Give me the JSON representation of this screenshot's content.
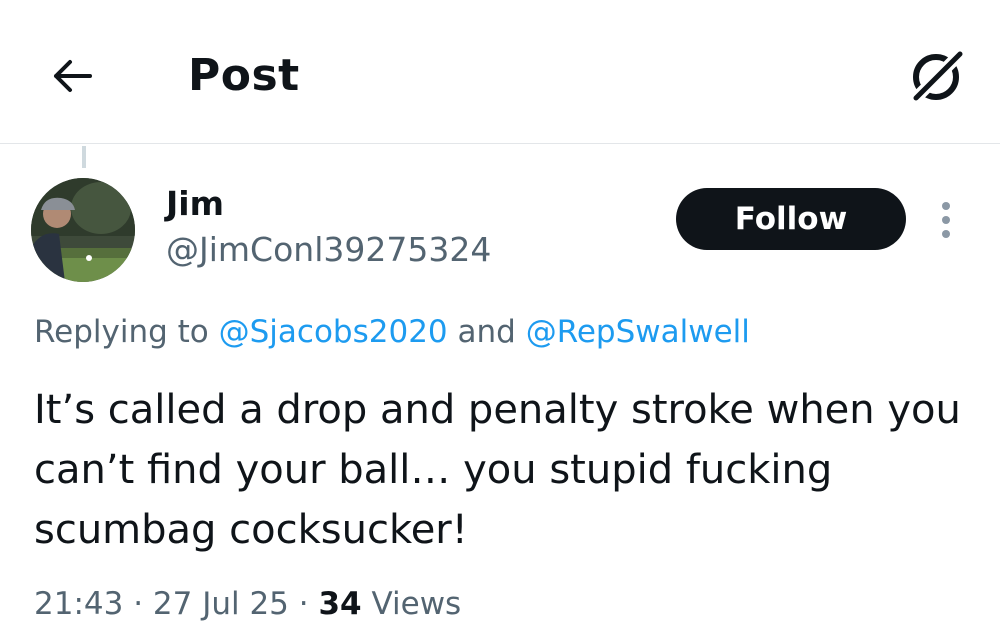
{
  "header": {
    "title": "Post",
    "back_icon": "arrow-left-icon",
    "grok_icon": "grok-icon"
  },
  "tweet": {
    "author": {
      "display_name": "Jim",
      "handle": "@JimConl39275324"
    },
    "follow_label": "Follow",
    "replying_prefix": "Replying to ",
    "mention_1": "@Sjacobs2020",
    "replying_and": " and ",
    "mention_2": "@RepSwalwell",
    "text": "It’s called a drop and penalty stroke when you can’t find your ball… you stupid fucking scumbag cocksucker!",
    "time": "21:43",
    "sep_1": " · ",
    "date": "27 Jul 25",
    "sep_2": " · ",
    "views_count": "34",
    "views_label": " Views"
  },
  "colors": {
    "text": "#0f1419",
    "secondary": "#536471",
    "link": "#1d9bf0",
    "divider": "#e3e6e9",
    "follow_bg": "#0f1419"
  }
}
